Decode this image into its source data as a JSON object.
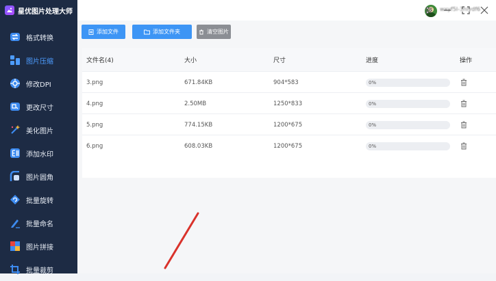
{
  "app": {
    "title": "星优图片处理大师"
  },
  "topbar": {
    "username": "wxyf5l-3nlydf6"
  },
  "sidebar": {
    "items": [
      {
        "label": "格式转换",
        "icon": "format-convert-icon"
      },
      {
        "label": "图片压缩",
        "icon": "image-compress-icon",
        "active": true
      },
      {
        "label": "修改DPI",
        "icon": "dpi-icon"
      },
      {
        "label": "更改尺寸",
        "icon": "resize-icon"
      },
      {
        "label": "美化图片",
        "icon": "beautify-icon"
      },
      {
        "label": "添加水印",
        "icon": "watermark-icon"
      },
      {
        "label": "图片圆角",
        "icon": "round-corner-icon"
      },
      {
        "label": "批量旋转",
        "icon": "rotate-icon"
      },
      {
        "label": "批量命名",
        "icon": "rename-icon"
      },
      {
        "label": "图片拼接",
        "icon": "stitch-icon"
      },
      {
        "label": "批量裁剪",
        "icon": "crop-icon"
      }
    ]
  },
  "toolbar": {
    "add_file": "添加文件",
    "add_folder": "添加文件夹",
    "clear": "清空图片"
  },
  "table": {
    "headers": {
      "name": "文件名(4)",
      "size": "大小",
      "dimensions": "尺寸",
      "progress": "进度",
      "actions": "操作"
    },
    "rows": [
      {
        "name": "3.png",
        "size": "671.84KB",
        "dimensions": "904*583",
        "progress": "0%"
      },
      {
        "name": "4.png",
        "size": "2.50MB",
        "dimensions": "1250*833",
        "progress": "0%"
      },
      {
        "name": "5.png",
        "size": "774.15KB",
        "dimensions": "1200*675",
        "progress": "0%"
      },
      {
        "name": "6.png",
        "size": "608.03KB",
        "dimensions": "1200*675",
        "progress": "0%"
      }
    ]
  },
  "colors": {
    "sidebar_bg": "#1d2b44",
    "accent": "#3d95f5",
    "active": "#4d9cff",
    "arrow": "#d9322b"
  }
}
